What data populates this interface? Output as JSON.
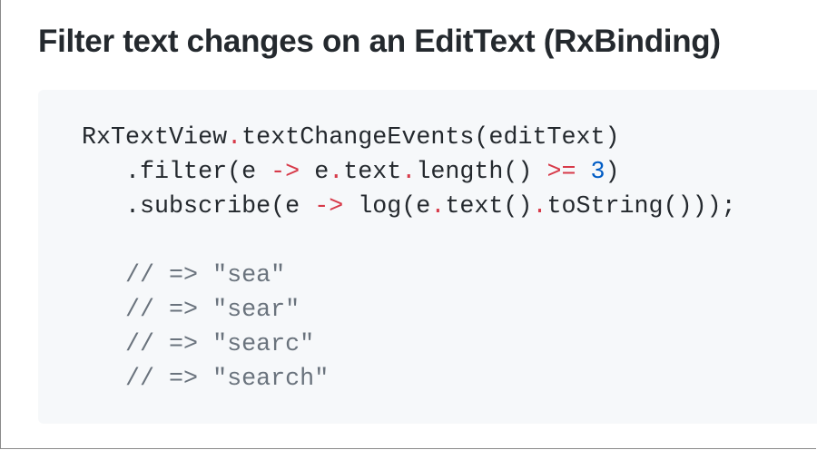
{
  "title": "Filter text changes on an EditText (RxBinding)",
  "colors": {
    "text": "#24292e",
    "operator": "#d73a49",
    "number": "#005cc5",
    "comment": "#6a737d",
    "code_background": "#f6f8fa"
  },
  "code": {
    "line1": {
      "a": "RxTextView",
      "dot": ".",
      "b": "textChangeEvents(editText)"
    },
    "line2": {
      "a": ".filter(e ",
      "arrow": "->",
      "b": " e",
      "dot1": ".",
      "c": "text",
      "dot2": ".",
      "d": "length() ",
      "gte": ">=",
      "e": " ",
      "num": "3",
      "f": ")"
    },
    "line3": {
      "a": ".subscribe(e ",
      "arrow": "->",
      "b": " log(e",
      "dot1": ".",
      "c": "text()",
      "dot2": ".",
      "d": "toString()));"
    },
    "comments": [
      "// => \"sea\"",
      "// => \"sear\"",
      "// => \"searc\"",
      "// => \"search\""
    ]
  }
}
